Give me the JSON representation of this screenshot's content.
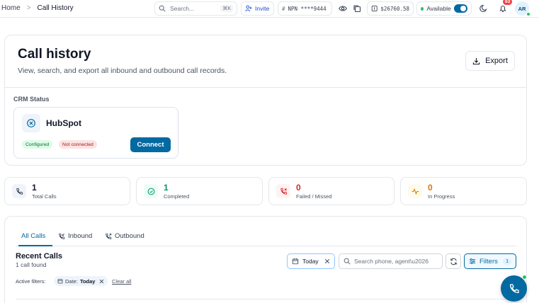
{
  "breadcrumb": {
    "home": "Home",
    "separator": ">",
    "current": "Call History"
  },
  "topbar": {
    "search_placeholder": "Search...",
    "search_shortcut": "⌘K",
    "invite_label": "Invite",
    "npn_label": "NPN ****9444",
    "balance": "$26760.58",
    "availability_label": "Available",
    "availability_on": true,
    "notification_count": "63",
    "avatar_initials": "AR"
  },
  "header": {
    "title": "Call history",
    "subtitle": "View, search, and export all inbound and outbound call records.",
    "export_label": "Export"
  },
  "crm": {
    "section_label": "CRM Status",
    "name": "HubSpot",
    "badge_configured": "Configured",
    "badge_status": "Not connected",
    "connect_label": "Connect"
  },
  "stats": [
    {
      "value": "1",
      "label": "Total Calls",
      "icon": "phone-icon",
      "color": "#111827",
      "bg": "#eef4fa"
    },
    {
      "value": "1",
      "label": "Completed",
      "icon": "check-circle-icon",
      "color": "#059669",
      "bg": "#ecfdf5"
    },
    {
      "value": "0",
      "label": "Failed / Missed",
      "icon": "phone-missed-icon",
      "color": "#dc2626",
      "bg": "#fef2f2"
    },
    {
      "value": "0",
      "label": "In Progress",
      "icon": "activity-icon",
      "color": "#d97706",
      "bg": "#fffbeb"
    }
  ],
  "tabs": [
    {
      "label": "All Calls",
      "active": true
    },
    {
      "label": "Inbound",
      "active": false
    },
    {
      "label": "Outbound",
      "active": false
    }
  ],
  "calls": {
    "title": "Recent Calls",
    "count_text": "1 call found",
    "date_filter": "Today",
    "search_placeholder": "Search phone, agent\\u2026",
    "filters_label": "Filters",
    "filters_count": "1",
    "active_filters_label": "Active filters:",
    "active_filter_key": "Date:",
    "active_filter_value": "Today",
    "clear_all_label": "Clear all"
  },
  "colors": {
    "accent": "#0369a1",
    "success": "#22c55e",
    "danger": "#ef4444"
  }
}
